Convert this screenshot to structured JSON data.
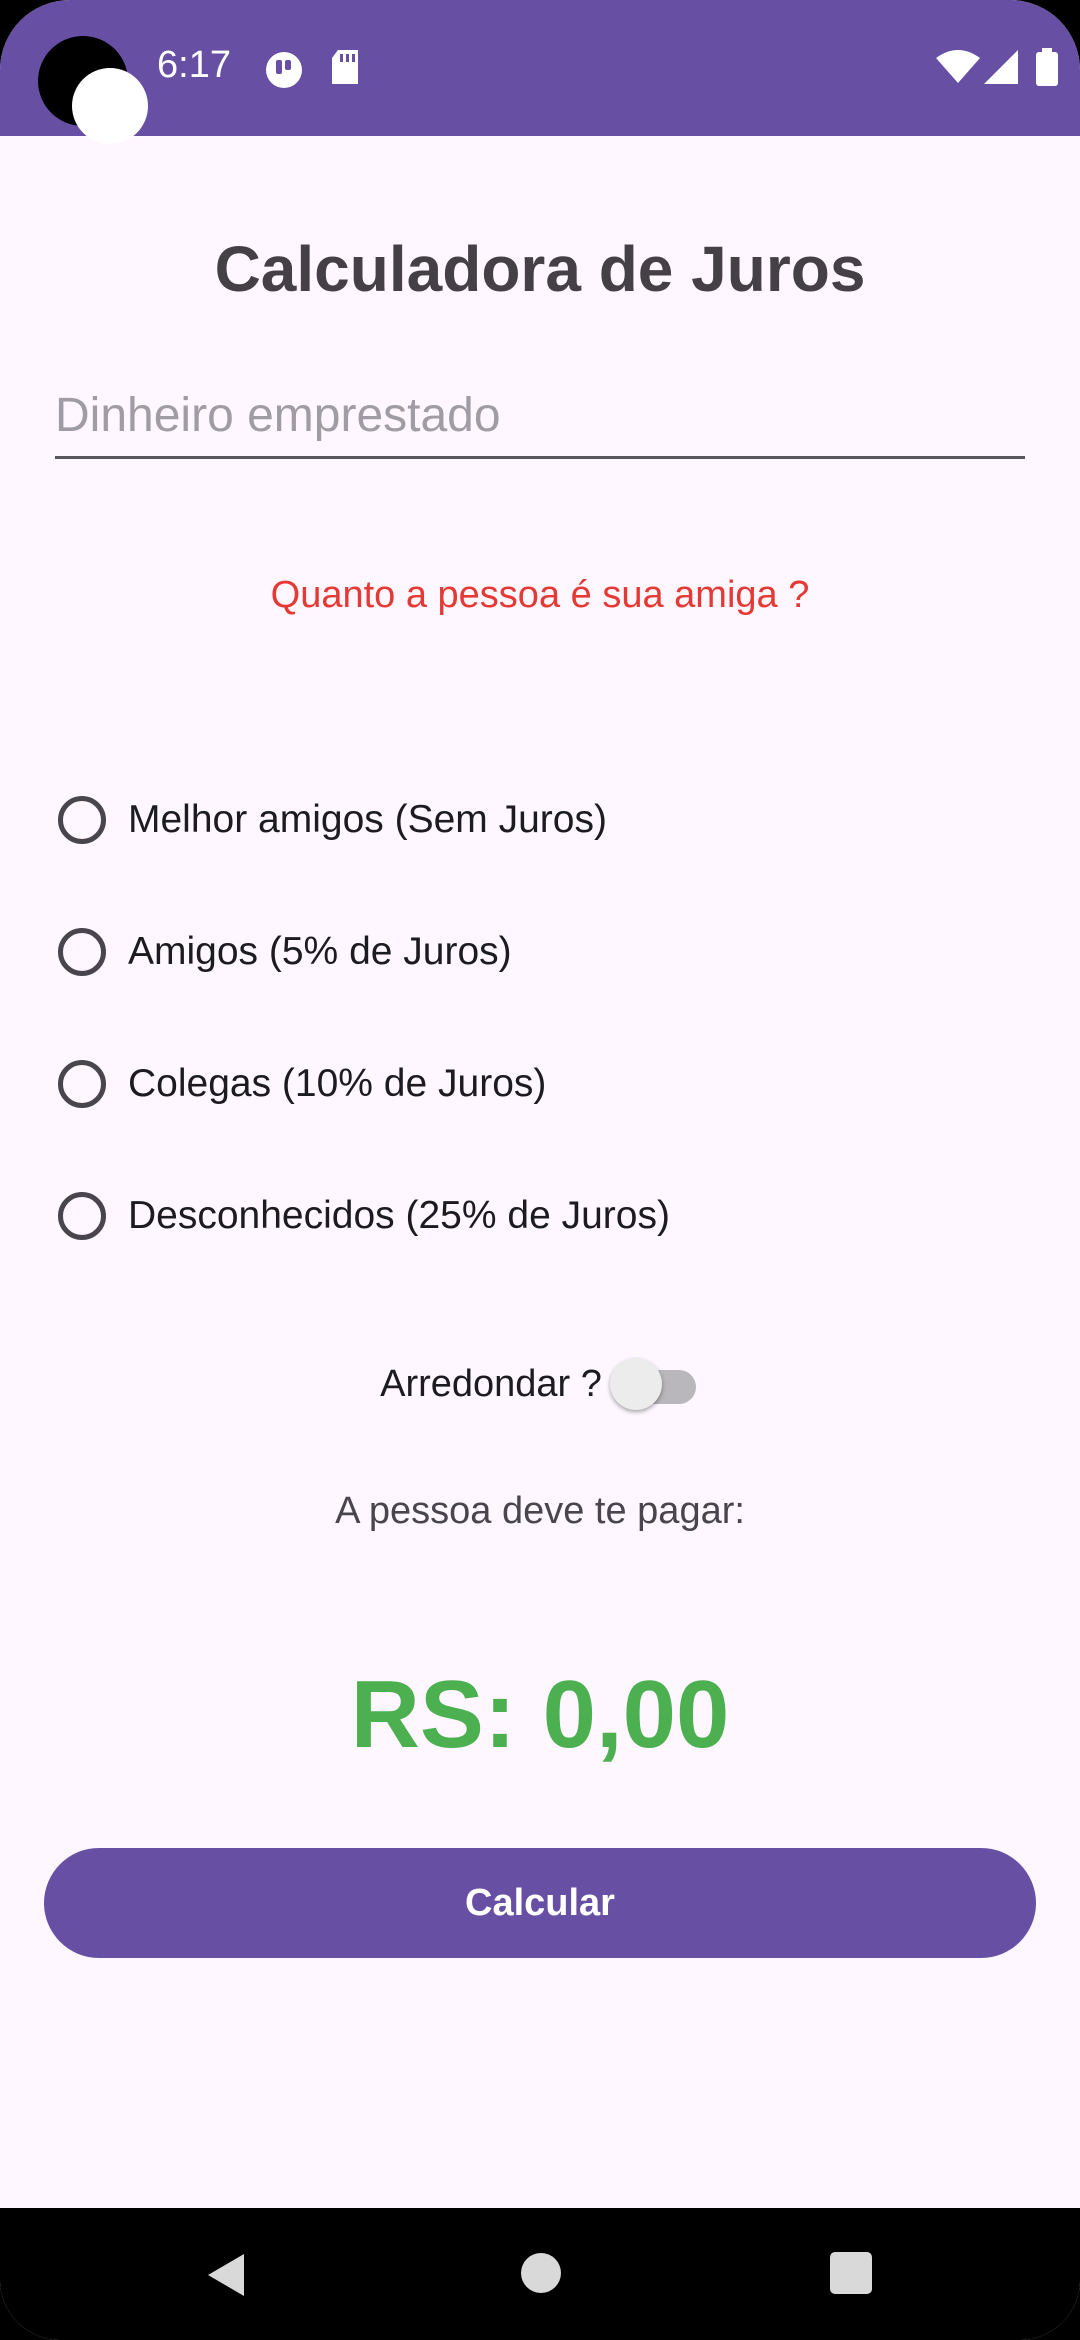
{
  "status_bar": {
    "time": "6:17",
    "background": "#6750A4",
    "left_icons": [
      "notification-app-icon",
      "sd-card-icon"
    ],
    "right_icons": [
      "wifi-icon",
      "cell-signal-icon",
      "battery-icon"
    ]
  },
  "app": {
    "title": "Calculadora de Juros",
    "amount_input": {
      "placeholder": "Dinheiro emprestado",
      "value": ""
    },
    "question": "Quanto a pessoa é sua amiga ?",
    "options": [
      {
        "label": "Melhor amigos (Sem Juros)",
        "selected": false
      },
      {
        "label": "Amigos (5% de Juros)",
        "selected": false
      },
      {
        "label": "Colegas (10% de Juros)",
        "selected": false
      },
      {
        "label": "Desconhecidos (25% de Juros)",
        "selected": false
      }
    ],
    "round_switch": {
      "label": "Arredondar ?",
      "on": false
    },
    "owe_label": "A pessoa deve te pagar:",
    "result": "RS: 0,00",
    "calculate_button": "Calcular"
  },
  "colors": {
    "primary": "#6750A4",
    "question_text": "#E53935",
    "result_text": "#4CAF50",
    "background": "#FEF7FF"
  },
  "nav_bar": {
    "icons": [
      "back-icon",
      "home-icon",
      "recents-icon"
    ]
  }
}
